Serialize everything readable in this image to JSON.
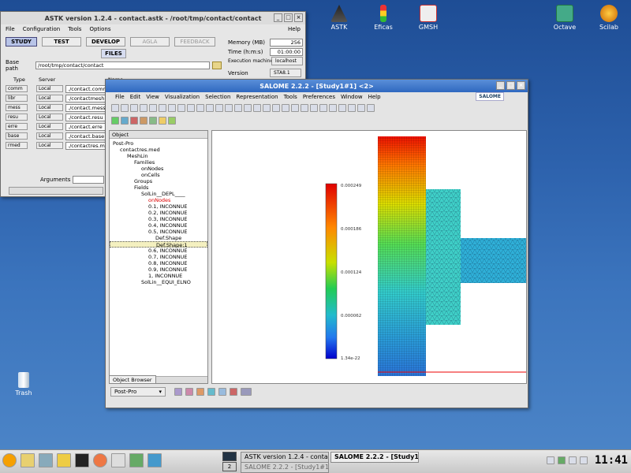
{
  "desktop": {
    "icons": [
      {
        "label": "ASTK"
      },
      {
        "label": "Eficas"
      },
      {
        "label": "GMSH"
      },
      {
        "label": "Octave"
      },
      {
        "label": "Scilab"
      },
      {
        "label": "Trash"
      }
    ]
  },
  "astk": {
    "title": "ASTK version 1.2.4 - contact.astk - /root/tmp/contact/contact",
    "menu": [
      "File",
      "Configuration",
      "Tools",
      "Options"
    ],
    "help": "Help",
    "tabs": [
      "STUDY",
      "TEST",
      "DEVELOP",
      "AGLA",
      "FEEDBACK"
    ],
    "files_btn": "FILES",
    "base_path_label": "Base path",
    "base_path": "/root/tmp/contact/contact",
    "memory_label": "Memory (MB)",
    "memory": "256",
    "time_label": "Time (h:m:s)",
    "time": "01:00:00",
    "exec_label": "Execution machine",
    "exec": "localhost",
    "version_label": "Version",
    "version": "STA8.1",
    "col_type": "Type",
    "col_server": "Server",
    "col_name": "Name",
    "rows": [
      {
        "type": "comm",
        "server": "Local",
        "name": "./contact.comm"
      },
      {
        "type": "libr",
        "server": "Local",
        "name": "./contactmesh.med"
      },
      {
        "type": "mess",
        "server": "Local",
        "name": "./contact.mess"
      },
      {
        "type": "resu",
        "server": "Local",
        "name": "./contact.resu"
      },
      {
        "type": "erre",
        "server": "Local",
        "name": "./contact.erre"
      },
      {
        "type": "base",
        "server": "Local",
        "name": "./contact.base"
      },
      {
        "type": "rmed",
        "server": "Local",
        "name": "./contactres.med"
      }
    ],
    "arguments_label": "Arguments"
  },
  "salome": {
    "title": "SALOME 2.2.2 - [Study1#1] <2>",
    "menu": [
      "File",
      "Edit",
      "View",
      "Visualization",
      "Selection",
      "Representation",
      "Tools",
      "Preferences",
      "Window",
      "Help"
    ],
    "logo": "SALOME",
    "object_header": "Object",
    "tree": [
      {
        "t": "Post-Pro",
        "l": 0
      },
      {
        "t": "contactres.med",
        "l": 1
      },
      {
        "t": "MeshLin",
        "l": 2
      },
      {
        "t": "Families",
        "l": 3
      },
      {
        "t": "onNodes",
        "l": 4
      },
      {
        "t": "onCells",
        "l": 4
      },
      {
        "t": "Groups",
        "l": 3
      },
      {
        "t": "Fields",
        "l": 3
      },
      {
        "t": "SolLin__DEPL____",
        "l": 4
      },
      {
        "t": "onNodes",
        "l": 5,
        "red": true
      },
      {
        "t": "0.1, INCONNUE",
        "l": 5
      },
      {
        "t": "0.2, INCONNUE",
        "l": 5
      },
      {
        "t": "0.3, INCONNUE",
        "l": 5
      },
      {
        "t": "0.4, INCONNUE",
        "l": 5
      },
      {
        "t": "0.5, INCONNUE",
        "l": 5
      },
      {
        "t": "Def.Shape",
        "l": 6
      },
      {
        "t": "Def.Shape:1",
        "l": 6
      },
      {
        "t": "0.6, INCONNUE",
        "l": 5
      },
      {
        "t": "0.7, INCONNUE",
        "l": 5
      },
      {
        "t": "0.8, INCONNUE",
        "l": 5
      },
      {
        "t": "0.9, INCONNUE",
        "l": 5
      },
      {
        "t": "1, INCONNUE",
        "l": 5
      },
      {
        "t": "SolLin__EQUI_ELNO",
        "l": 4
      }
    ],
    "object_browser_tab": "Object Browser",
    "module": "Post-Pro",
    "legend": [
      "0.000249",
      "0.000186",
      "0.000124",
      "0.000062",
      "1.34e-22"
    ]
  },
  "taskbar": {
    "desk_num": "2",
    "tasks": [
      "ASTK version 1.2.4 - conta",
      "SALOME 2.2.2 - [Study1#1]",
      "SALOME 2.2.2 - [Study1#1]"
    ],
    "clock": "11:41"
  }
}
